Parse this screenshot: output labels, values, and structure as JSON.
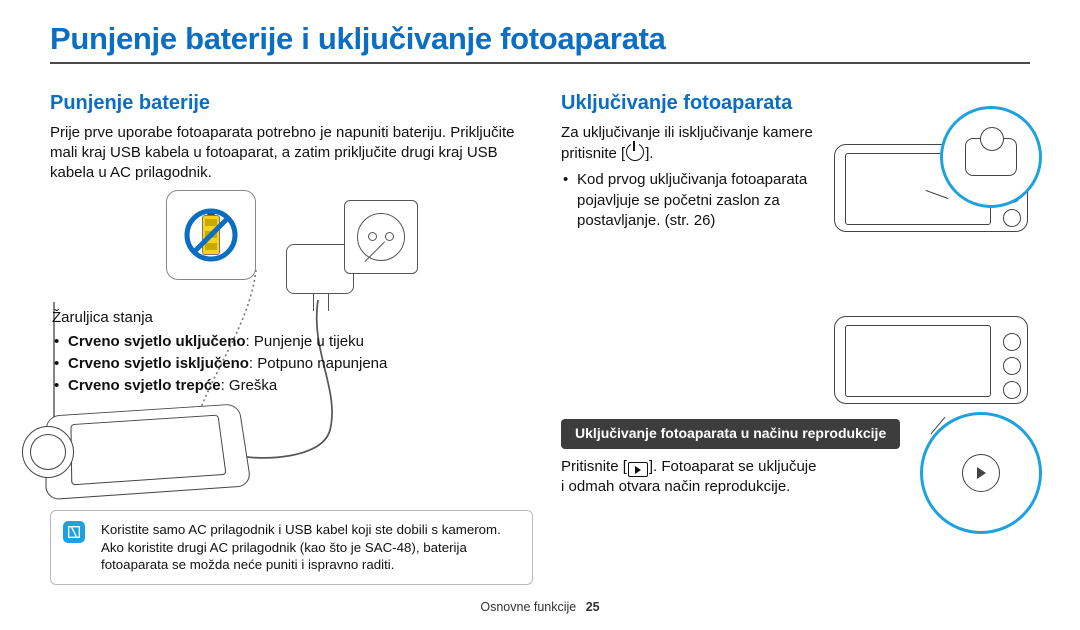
{
  "page_title": "Punjenje baterije i uključivanje fotoaparata",
  "left": {
    "heading": "Punjenje baterije",
    "intro": "Prije prve uporabe fotoaparata potrebno je napuniti bateriju. Priključite mali kraj USB kabela u fotoaparat, a zatim priključite drugi kraj USB kabela u AC prilagodnik.",
    "status_label": "Žaruljica stanja",
    "states": [
      {
        "bold": "Crveno svjetlo uključeno",
        "rest": ": Punjenje u tijeku"
      },
      {
        "bold": "Crveno svjetlo isključeno",
        "rest": ": Potpuno napunjena"
      },
      {
        "bold": "Crveno svjetlo trepće",
        "rest": ": Greška"
      }
    ],
    "note": "Koristite samo AC prilagodnik i USB kabel koji ste dobili s kamerom. Ako koristite drugi AC prilagodnik (kao što je SAC-48), baterija fotoaparata se možda neće puniti i ispravno raditi."
  },
  "right": {
    "heading": "Uključivanje fotoaparata",
    "intro_pre": "Za uključivanje ili isključivanje kamere pritisnite [",
    "intro_post": "].",
    "bullet": "Kod prvog uključivanja fotoaparata pojavljuje se početni zaslon za postavljanje. (str. 26)",
    "sub_heading": "Uključivanje fotoaparata u načinu reprodukcije",
    "play_pre": "Pritisnite [",
    "play_post": "]. Fotoaparat se uključuje i odmah otvara način reprodukcije."
  },
  "footer": {
    "section": "Osnovne funkcije",
    "page": "25"
  },
  "icons": {
    "power": "power-icon",
    "playback": "playback-icon",
    "note": "note-icon",
    "prohibited_battery": "no-battery-direct-charge-icon"
  }
}
